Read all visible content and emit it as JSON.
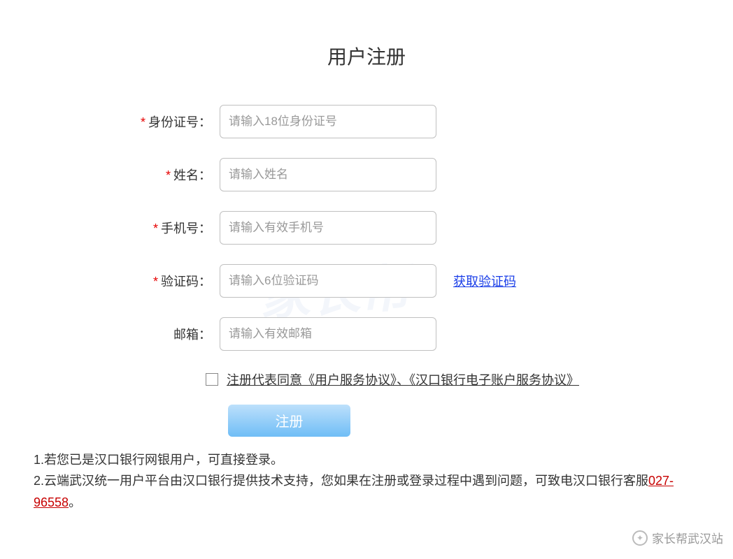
{
  "title": "用户注册",
  "form": {
    "id_number": {
      "label": "身份证号：",
      "placeholder": "请输入18位身份证号",
      "required": true
    },
    "name": {
      "label": "姓名：",
      "placeholder": "请输入姓名",
      "required": true
    },
    "phone": {
      "label": "手机号：",
      "placeholder": "请输入有效手机号",
      "required": true
    },
    "captcha": {
      "label": "验证码：",
      "placeholder": "请输入6位验证码",
      "required": true,
      "get_code_label": "获取验证码"
    },
    "email": {
      "label": "邮箱：",
      "placeholder": "请输入有效邮箱",
      "required": false
    }
  },
  "agreement": {
    "text": "注册代表同意《用户服务协议》、《汉口银行电子账户服务协议》"
  },
  "submit_label": "注册",
  "notes": {
    "line1": "1.若您已是汉口银行网银用户，可直接登录。",
    "line2_prefix": "2.云端武汉统一用户平台由汉口银行提供技术支持，您如果在注册或登录过程中遇到问题，可致电汉口银行客服",
    "phone": "027-96558",
    "line2_suffix": "。"
  },
  "watermark": {
    "source": "家长帮武汉站",
    "bg_text": "家长帮"
  }
}
